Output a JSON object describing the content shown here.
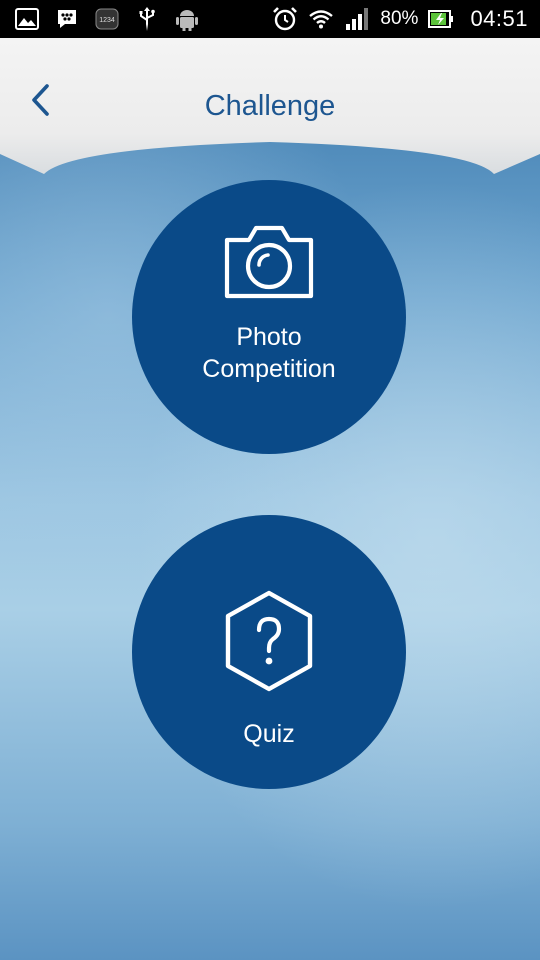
{
  "status_bar": {
    "icons_left": [
      "gallery-icon",
      "bbm-icon",
      "app-1234-icon",
      "usb-icon",
      "android-debug-icon"
    ],
    "app_badge": "1234",
    "icons_right": [
      "alarm-icon",
      "wifi-icon",
      "signal-icon",
      "battery-icon"
    ],
    "battery_percent": "80%",
    "time": "04:51"
  },
  "header": {
    "title": "Challenge",
    "back_icon": "chevron-left-icon"
  },
  "buttons": {
    "photo": {
      "label_line1": "Photo",
      "label_line2": "Competition",
      "icon": "camera-icon"
    },
    "quiz": {
      "label": "Quiz",
      "icon": "question-hexagon-icon"
    }
  },
  "colors": {
    "header_text": "#1d5690",
    "button_fill": "#0a4a88",
    "button_text": "#ffffff"
  }
}
